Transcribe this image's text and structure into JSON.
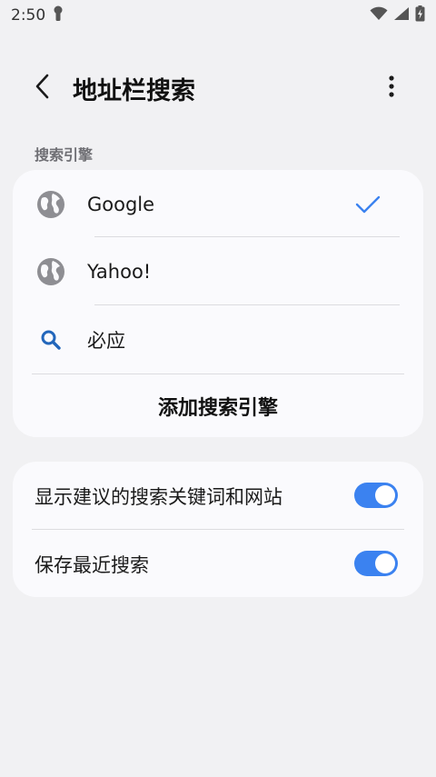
{
  "status_bar": {
    "time": "2:50",
    "icons": [
      "notification-key-icon",
      "wifi-icon",
      "signal-icon",
      "battery-charging-icon"
    ]
  },
  "app_bar": {
    "title": "地址栏搜索",
    "back_icon": "chevron-left-icon",
    "more_icon": "more-vertical-icon"
  },
  "search_engines": {
    "section_label": "搜索引擎",
    "items": [
      {
        "label": "Google",
        "icon": "globe-icon",
        "selected": true
      },
      {
        "label": "Yahoo!",
        "icon": "globe-icon",
        "selected": false
      },
      {
        "label": "必应",
        "icon": "search-icon",
        "selected": false
      }
    ],
    "add_label": "添加搜索引擎"
  },
  "preferences": {
    "items": [
      {
        "label": "显示建议的搜索关键词和网站",
        "enabled": true
      },
      {
        "label": "保存最近搜索",
        "enabled": true
      }
    ]
  },
  "colors": {
    "accent": "#3b82f0",
    "check": "#3b82f0",
    "search_icon": "#2266bb",
    "globe_icon": "#8e8e93",
    "background": "#f1f1f3",
    "card": "#fafafd"
  }
}
